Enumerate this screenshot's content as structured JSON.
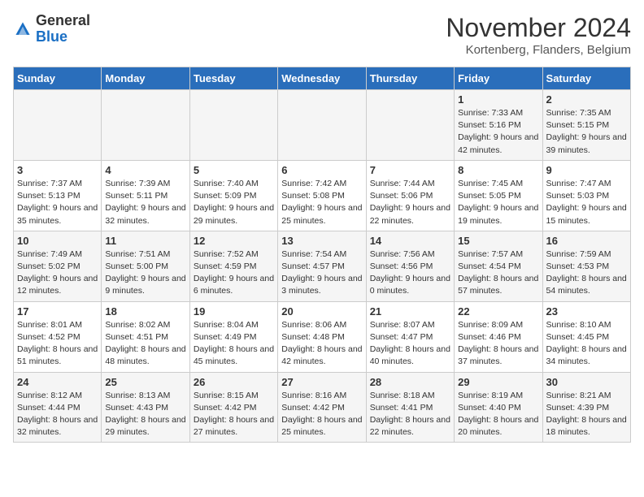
{
  "logo": {
    "general": "General",
    "blue": "Blue"
  },
  "header": {
    "title": "November 2024",
    "location": "Kortenberg, Flanders, Belgium"
  },
  "days_of_week": [
    "Sunday",
    "Monday",
    "Tuesday",
    "Wednesday",
    "Thursday",
    "Friday",
    "Saturday"
  ],
  "weeks": [
    [
      {
        "day": "",
        "info": ""
      },
      {
        "day": "",
        "info": ""
      },
      {
        "day": "",
        "info": ""
      },
      {
        "day": "",
        "info": ""
      },
      {
        "day": "",
        "info": ""
      },
      {
        "day": "1",
        "info": "Sunrise: 7:33 AM\nSunset: 5:16 PM\nDaylight: 9 hours and 42 minutes."
      },
      {
        "day": "2",
        "info": "Sunrise: 7:35 AM\nSunset: 5:15 PM\nDaylight: 9 hours and 39 minutes."
      }
    ],
    [
      {
        "day": "3",
        "info": "Sunrise: 7:37 AM\nSunset: 5:13 PM\nDaylight: 9 hours and 35 minutes."
      },
      {
        "day": "4",
        "info": "Sunrise: 7:39 AM\nSunset: 5:11 PM\nDaylight: 9 hours and 32 minutes."
      },
      {
        "day": "5",
        "info": "Sunrise: 7:40 AM\nSunset: 5:09 PM\nDaylight: 9 hours and 29 minutes."
      },
      {
        "day": "6",
        "info": "Sunrise: 7:42 AM\nSunset: 5:08 PM\nDaylight: 9 hours and 25 minutes."
      },
      {
        "day": "7",
        "info": "Sunrise: 7:44 AM\nSunset: 5:06 PM\nDaylight: 9 hours and 22 minutes."
      },
      {
        "day": "8",
        "info": "Sunrise: 7:45 AM\nSunset: 5:05 PM\nDaylight: 9 hours and 19 minutes."
      },
      {
        "day": "9",
        "info": "Sunrise: 7:47 AM\nSunset: 5:03 PM\nDaylight: 9 hours and 15 minutes."
      }
    ],
    [
      {
        "day": "10",
        "info": "Sunrise: 7:49 AM\nSunset: 5:02 PM\nDaylight: 9 hours and 12 minutes."
      },
      {
        "day": "11",
        "info": "Sunrise: 7:51 AM\nSunset: 5:00 PM\nDaylight: 9 hours and 9 minutes."
      },
      {
        "day": "12",
        "info": "Sunrise: 7:52 AM\nSunset: 4:59 PM\nDaylight: 9 hours and 6 minutes."
      },
      {
        "day": "13",
        "info": "Sunrise: 7:54 AM\nSunset: 4:57 PM\nDaylight: 9 hours and 3 minutes."
      },
      {
        "day": "14",
        "info": "Sunrise: 7:56 AM\nSunset: 4:56 PM\nDaylight: 9 hours and 0 minutes."
      },
      {
        "day": "15",
        "info": "Sunrise: 7:57 AM\nSunset: 4:54 PM\nDaylight: 8 hours and 57 minutes."
      },
      {
        "day": "16",
        "info": "Sunrise: 7:59 AM\nSunset: 4:53 PM\nDaylight: 8 hours and 54 minutes."
      }
    ],
    [
      {
        "day": "17",
        "info": "Sunrise: 8:01 AM\nSunset: 4:52 PM\nDaylight: 8 hours and 51 minutes."
      },
      {
        "day": "18",
        "info": "Sunrise: 8:02 AM\nSunset: 4:51 PM\nDaylight: 8 hours and 48 minutes."
      },
      {
        "day": "19",
        "info": "Sunrise: 8:04 AM\nSunset: 4:49 PM\nDaylight: 8 hours and 45 minutes."
      },
      {
        "day": "20",
        "info": "Sunrise: 8:06 AM\nSunset: 4:48 PM\nDaylight: 8 hours and 42 minutes."
      },
      {
        "day": "21",
        "info": "Sunrise: 8:07 AM\nSunset: 4:47 PM\nDaylight: 8 hours and 40 minutes."
      },
      {
        "day": "22",
        "info": "Sunrise: 8:09 AM\nSunset: 4:46 PM\nDaylight: 8 hours and 37 minutes."
      },
      {
        "day": "23",
        "info": "Sunrise: 8:10 AM\nSunset: 4:45 PM\nDaylight: 8 hours and 34 minutes."
      }
    ],
    [
      {
        "day": "24",
        "info": "Sunrise: 8:12 AM\nSunset: 4:44 PM\nDaylight: 8 hours and 32 minutes."
      },
      {
        "day": "25",
        "info": "Sunrise: 8:13 AM\nSunset: 4:43 PM\nDaylight: 8 hours and 29 minutes."
      },
      {
        "day": "26",
        "info": "Sunrise: 8:15 AM\nSunset: 4:42 PM\nDaylight: 8 hours and 27 minutes."
      },
      {
        "day": "27",
        "info": "Sunrise: 8:16 AM\nSunset: 4:42 PM\nDaylight: 8 hours and 25 minutes."
      },
      {
        "day": "28",
        "info": "Sunrise: 8:18 AM\nSunset: 4:41 PM\nDaylight: 8 hours and 22 minutes."
      },
      {
        "day": "29",
        "info": "Sunrise: 8:19 AM\nSunset: 4:40 PM\nDaylight: 8 hours and 20 minutes."
      },
      {
        "day": "30",
        "info": "Sunrise: 8:21 AM\nSunset: 4:39 PM\nDaylight: 8 hours and 18 minutes."
      }
    ]
  ]
}
